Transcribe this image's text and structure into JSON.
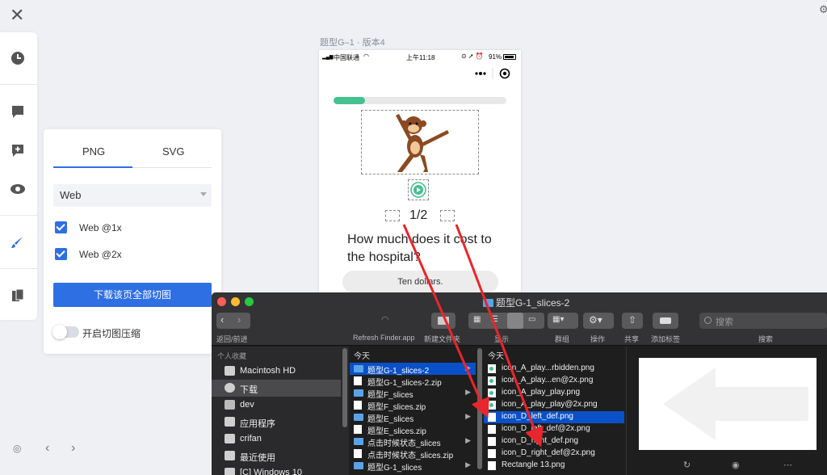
{
  "toolbar": {
    "close_icon": "close-icon",
    "rail_icons": [
      "clock-icon",
      "comment-icon",
      "add-comment-icon",
      "eye-icon",
      "brush-icon",
      "slices-icon"
    ]
  },
  "export_panel": {
    "tabs": [
      {
        "label": "PNG",
        "active": true
      },
      {
        "label": "SVG",
        "active": false
      }
    ],
    "platform": "Web",
    "options": [
      {
        "label": "Web @1x",
        "checked": true
      },
      {
        "label": "Web @2x",
        "checked": true
      }
    ],
    "download_label": "下载该页全部切图",
    "compress_label": "开启切图压缩",
    "compress_on": false,
    "accent": "#2f6fe4"
  },
  "artboard": {
    "title": "题型G–1 · 版本4",
    "status": {
      "carrier": "中国联通",
      "time": "上午11:18",
      "battery": "91%"
    },
    "progress": 0.18,
    "counter": "1/2",
    "question": "How much does it cost to the hospital?",
    "answer": "Ten dollars.",
    "progress_color": "#45c08f"
  },
  "finder": {
    "title": "题型G-1_slices-2",
    "toolbar_labels": [
      "返回/前进",
      "Refresh Finder.app",
      "新建文件夹",
      "显示",
      "群组",
      "操作",
      "共享",
      "添加标签",
      "搜索"
    ],
    "search_placeholder": "搜索",
    "sidebar": {
      "header": "个人收藏",
      "items": [
        {
          "label": "Macintosh HD",
          "icon": "hard-drive-icon",
          "selected": false
        },
        {
          "label": "下载",
          "icon": "downloads-icon",
          "selected": true
        },
        {
          "label": "dev",
          "icon": "folder-icon",
          "selected": false
        },
        {
          "label": "应用程序",
          "icon": "applications-icon",
          "selected": false
        },
        {
          "label": "crifan",
          "icon": "home-icon",
          "selected": false
        },
        {
          "label": "最近使用",
          "icon": "recents-icon",
          "selected": false
        },
        {
          "label": "[C] Windows 10",
          "icon": "disk-icon",
          "selected": false
        }
      ]
    },
    "column1": {
      "header": "今天",
      "rows": [
        {
          "name": "题型G-1_slices-2",
          "type": "folder",
          "selected": true
        },
        {
          "name": "题型G-1_slices-2.zip",
          "type": "file"
        },
        {
          "name": "题型F_slices",
          "type": "folder"
        },
        {
          "name": "题型F_slices.zip",
          "type": "file"
        },
        {
          "name": "题型E_slices",
          "type": "folder"
        },
        {
          "name": "题型E_slices.zip",
          "type": "file"
        },
        {
          "name": "点击时候状态_slices",
          "type": "folder"
        },
        {
          "name": "点击时候状态_slices.zip",
          "type": "file"
        },
        {
          "name": "题型G-1_slices",
          "type": "folder"
        }
      ]
    },
    "column2": {
      "header": "今天",
      "rows": [
        {
          "name": "icon_A_play...rbidden.png",
          "type": "green"
        },
        {
          "name": "icon_A_play...en@2x.png",
          "type": "green"
        },
        {
          "name": "icon_A_play_play.png",
          "type": "green"
        },
        {
          "name": "icon_A_play_play@2x.png",
          "type": "green"
        },
        {
          "name": "icon_D_left_def.png",
          "type": "white",
          "selected": true
        },
        {
          "name": "icon_D_left_def@2x.png",
          "type": "white"
        },
        {
          "name": "icon_D_right_def.png",
          "type": "white"
        },
        {
          "name": "icon_D_right_def@2x.png",
          "type": "white"
        },
        {
          "name": "Rectangle 13.png",
          "type": "white"
        }
      ]
    },
    "preview_icons": [
      "rotate-icon",
      "markup-icon",
      "more-icon"
    ]
  }
}
